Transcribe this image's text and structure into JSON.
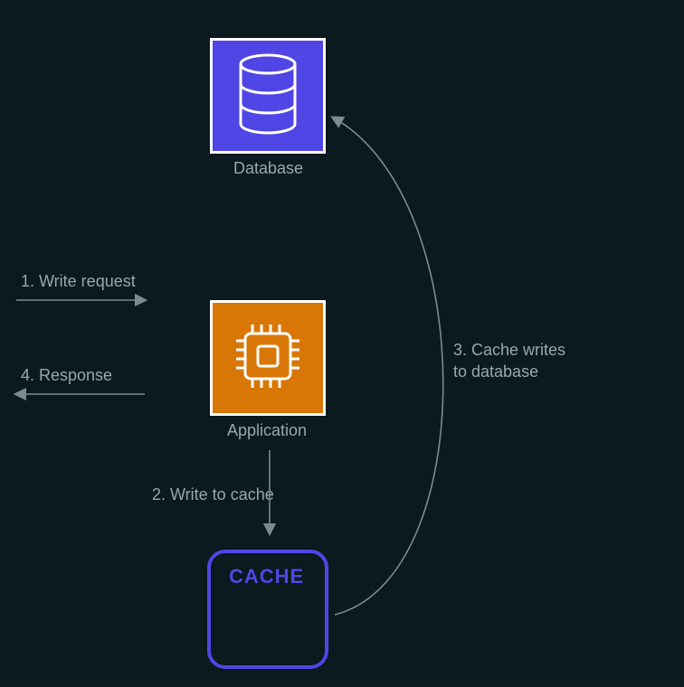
{
  "nodes": {
    "database": {
      "label": "Database"
    },
    "application": {
      "label": "Application"
    },
    "cache": {
      "label": "CACHE"
    }
  },
  "steps": {
    "s1": "1. Write request",
    "s2": "2. Write to cache",
    "s3": "3. Cache writes\nto database",
    "s4": "4. Response"
  }
}
